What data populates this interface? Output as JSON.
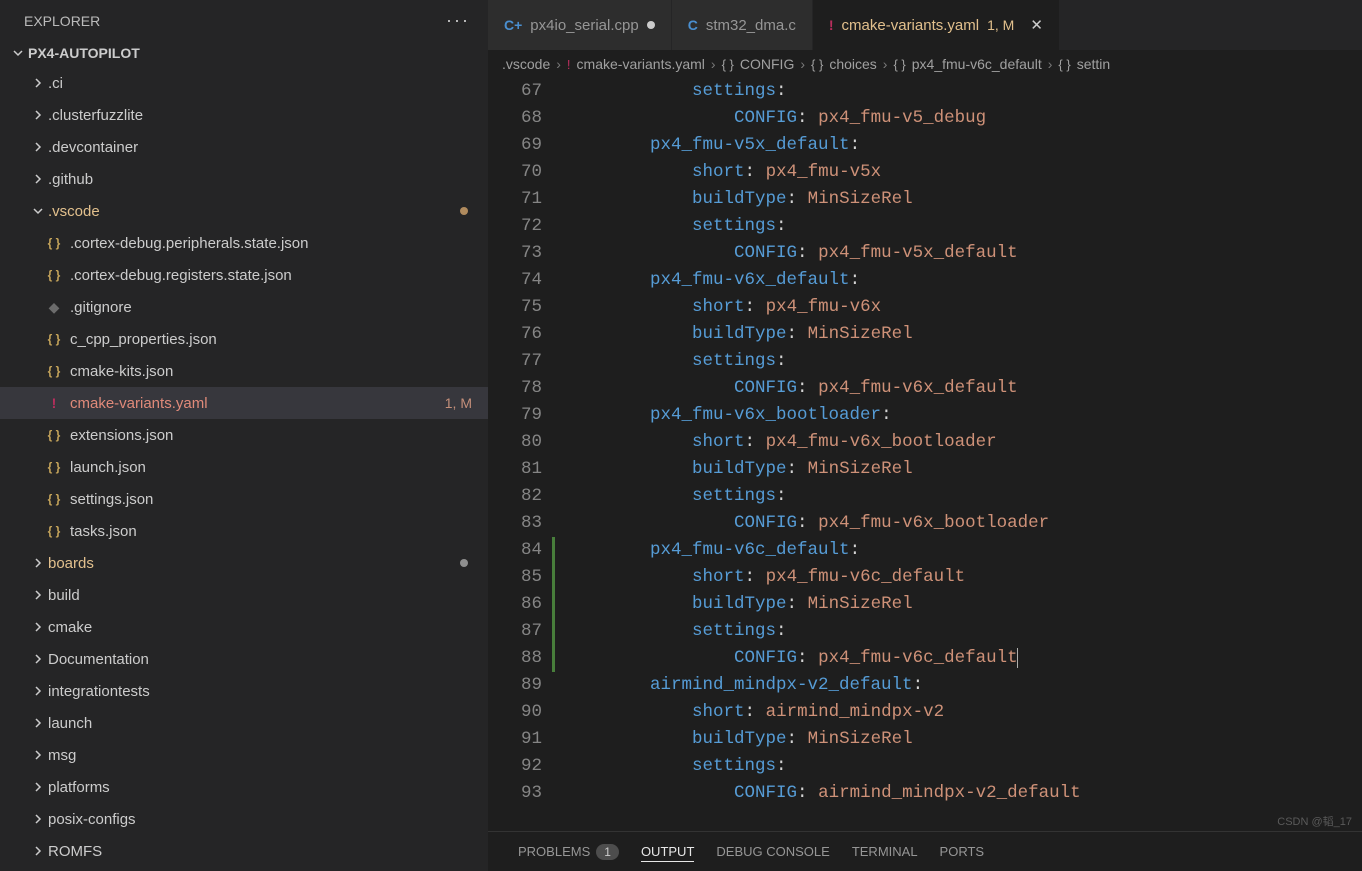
{
  "explorer": {
    "title": "EXPLORER",
    "root": "PX4-AUTOPILOT",
    "items": [
      {
        "name": ".ci",
        "type": "folder"
      },
      {
        "name": ".clusterfuzzlite",
        "type": "folder"
      },
      {
        "name": ".devcontainer",
        "type": "folder"
      },
      {
        "name": ".github",
        "type": "folder"
      },
      {
        "name": ".vscode",
        "type": "folder",
        "expanded": true,
        "status": "modified",
        "color": "orange"
      },
      {
        "name": ".cortex-debug.peripherals.state.json",
        "type": "json",
        "sub": true
      },
      {
        "name": ".cortex-debug.registers.state.json",
        "type": "json",
        "sub": true
      },
      {
        "name": ".gitignore",
        "type": "git",
        "sub": true
      },
      {
        "name": "c_cpp_properties.json",
        "type": "json",
        "sub": true
      },
      {
        "name": "cmake-kits.json",
        "type": "json",
        "sub": true
      },
      {
        "name": "cmake-variants.yaml",
        "type": "yaml",
        "sub": true,
        "active": true,
        "badge": "1, M",
        "color": "red"
      },
      {
        "name": "extensions.json",
        "type": "json",
        "sub": true
      },
      {
        "name": "launch.json",
        "type": "json",
        "sub": true
      },
      {
        "name": "settings.json",
        "type": "json",
        "sub": true
      },
      {
        "name": "tasks.json",
        "type": "json",
        "sub": true
      },
      {
        "name": "boards",
        "type": "folder",
        "status": "untracked",
        "color": "orange"
      },
      {
        "name": "build",
        "type": "folder"
      },
      {
        "name": "cmake",
        "type": "folder"
      },
      {
        "name": "Documentation",
        "type": "folder"
      },
      {
        "name": "integrationtests",
        "type": "folder"
      },
      {
        "name": "launch",
        "type": "folder"
      },
      {
        "name": "msg",
        "type": "folder"
      },
      {
        "name": "platforms",
        "type": "folder"
      },
      {
        "name": "posix-configs",
        "type": "folder"
      },
      {
        "name": "ROMFS",
        "type": "folder"
      }
    ]
  },
  "tabs": [
    {
      "icon": "cpp",
      "iconText": "C+",
      "label": "px4io_serial.cpp",
      "modified": true
    },
    {
      "icon": "c",
      "iconText": "C",
      "label": "stm32_dma.c"
    },
    {
      "icon": "yaml",
      "iconText": "!",
      "label": "cmake-variants.yaml",
      "badge": "1, M",
      "active": true,
      "close": true
    }
  ],
  "breadcrumb": [
    {
      "text": ".vscode"
    },
    {
      "icon": "!",
      "iconClass": "yml-ic",
      "text": "cmake-variants.yaml"
    },
    {
      "icon": "{ }",
      "text": "CONFIG"
    },
    {
      "icon": "{ }",
      "text": "choices"
    },
    {
      "icon": "{ }",
      "text": "px4_fmu-v6c_default"
    },
    {
      "icon": "{ }",
      "text": "settin"
    }
  ],
  "code": {
    "firstLine": 67,
    "lines": [
      {
        "indent": 3,
        "key": "settings",
        "val": ""
      },
      {
        "indent": 4,
        "key": "CONFIG",
        "val": "px4_fmu-v5_debug"
      },
      {
        "indent": 2,
        "key": "px4_fmu-v5x_default",
        "val": ""
      },
      {
        "indent": 3,
        "key": "short",
        "val": "px4_fmu-v5x"
      },
      {
        "indent": 3,
        "key": "buildType",
        "val": "MinSizeRel"
      },
      {
        "indent": 3,
        "key": "settings",
        "val": ""
      },
      {
        "indent": 4,
        "key": "CONFIG",
        "val": "px4_fmu-v5x_default"
      },
      {
        "indent": 2,
        "key": "px4_fmu-v6x_default",
        "val": ""
      },
      {
        "indent": 3,
        "key": "short",
        "val": "px4_fmu-v6x"
      },
      {
        "indent": 3,
        "key": "buildType",
        "val": "MinSizeRel"
      },
      {
        "indent": 3,
        "key": "settings",
        "val": ""
      },
      {
        "indent": 4,
        "key": "CONFIG",
        "val": "px4_fmu-v6x_default"
      },
      {
        "indent": 2,
        "key": "px4_fmu-v6x_bootloader",
        "val": ""
      },
      {
        "indent": 3,
        "key": "short",
        "val": "px4_fmu-v6x_bootloader"
      },
      {
        "indent": 3,
        "key": "buildType",
        "val": "MinSizeRel"
      },
      {
        "indent": 3,
        "key": "settings",
        "val": ""
      },
      {
        "indent": 4,
        "key": "CONFIG",
        "val": "px4_fmu-v6x_bootloader"
      },
      {
        "indent": 2,
        "key": "px4_fmu-v6c_default",
        "val": "",
        "green": true
      },
      {
        "indent": 3,
        "key": "short",
        "val": "px4_fmu-v6c_default",
        "green": true
      },
      {
        "indent": 3,
        "key": "buildType",
        "val": "MinSizeRel",
        "green": true
      },
      {
        "indent": 3,
        "key": "settings",
        "val": "",
        "green": true
      },
      {
        "indent": 4,
        "key": "CONFIG",
        "val": "px4_fmu-v6c_default",
        "green": true,
        "caret": true
      },
      {
        "indent": 2,
        "key": "airmind_mindpx-v2_default",
        "val": ""
      },
      {
        "indent": 3,
        "key": "short",
        "val": "airmind_mindpx-v2"
      },
      {
        "indent": 3,
        "key": "buildType",
        "val": "MinSizeRel"
      },
      {
        "indent": 3,
        "key": "settings",
        "val": ""
      },
      {
        "indent": 4,
        "key": "CONFIG",
        "val": "airmind_mindpx-v2_default"
      }
    ]
  },
  "panel": {
    "problems": "PROBLEMS",
    "problemsCount": "1",
    "output": "OUTPUT",
    "debug": "DEBUG CONSOLE",
    "terminal": "TERMINAL",
    "ports": "PORTS"
  },
  "watermark": "CSDN @韬_17"
}
